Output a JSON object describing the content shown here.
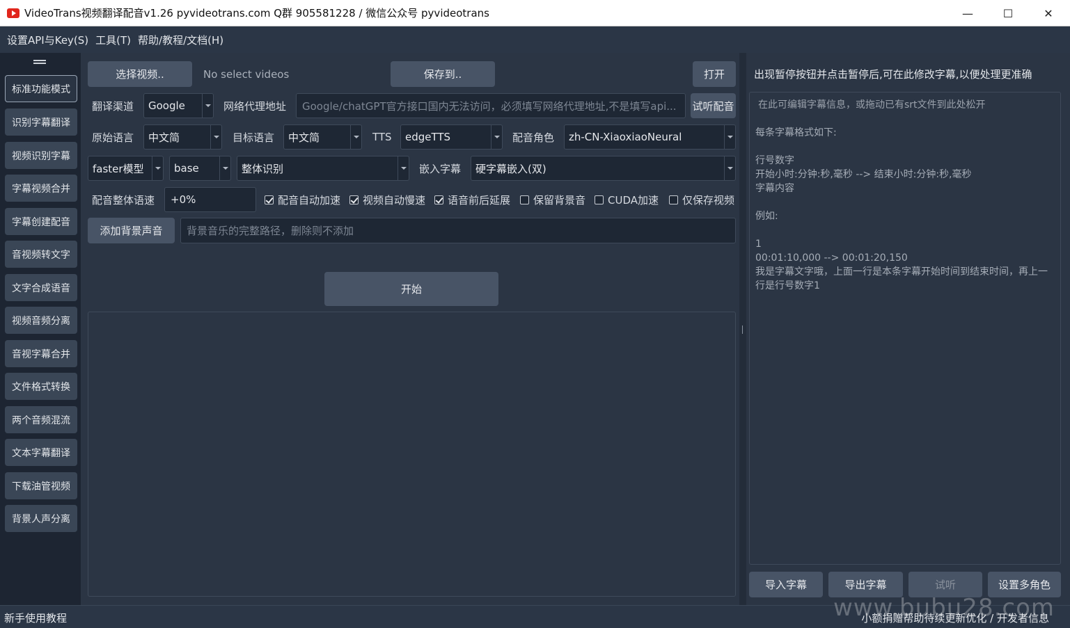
{
  "window": {
    "title": "VideoTrans视频翻译配音v1.26  pyvideotrans.com   Q群 905581228 / 微信公众号 pyvideotrans",
    "minimize": "—",
    "maximize": "☐",
    "close": "✕"
  },
  "menu": {
    "items": [
      "设置API与Key(S)",
      "工具(T)",
      "帮助/教程/文档(H)"
    ]
  },
  "sidebar": {
    "items": [
      "标准功能模式",
      "识别字幕翻译",
      "视频识别字幕",
      "字幕视频合并",
      "字幕创建配音",
      "音视频转文字",
      "文字合成语音",
      "视频音频分离",
      "音视字幕合并",
      "文件格式转换",
      "两个音频混流",
      "文本字幕翻译",
      "下载油管视频",
      "背景人声分离"
    ]
  },
  "main": {
    "select_video": "选择视频..",
    "no_video": "No select videos",
    "save_to": "保存到..",
    "open": "打开",
    "translate_channel_label": "翻译渠道",
    "translate_channel": "Google",
    "proxy_label": "网络代理地址",
    "proxy_placeholder": "Google/chatGPT官方接口国内无法访问，必须填写网络代理地址,不是填写api...",
    "listen_dub": "试听配音",
    "source_lang_label": "原始语言",
    "source_lang": "中文简",
    "target_lang_label": "目标语言",
    "target_lang": "中文简",
    "tts_label": "TTS",
    "tts": "edgeTTS",
    "voice_label": "配音角色",
    "voice": "zh-CN-XiaoxiaoNeural",
    "model_type": "faster模型",
    "model_size": "base",
    "recognition_mode": "整体识别",
    "embed_sub_label": "嵌入字幕",
    "embed_sub": "硬字幕嵌入(双)",
    "speed_label": "配音整体语速",
    "speed": "+0%",
    "checkboxes": [
      {
        "label": "配音自动加速",
        "checked": true
      },
      {
        "label": "视频自动慢速",
        "checked": true
      },
      {
        "label": "语音前后延展",
        "checked": true
      },
      {
        "label": "保留背景音",
        "checked": false
      },
      {
        "label": "CUDA加速",
        "checked": false
      },
      {
        "label": "仅保存视频",
        "checked": false
      }
    ],
    "add_bgm": "添加背景声音",
    "bgm_placeholder": "背景音乐的完整路径，删除则不添加",
    "start": "开始"
  },
  "right": {
    "tip": "出现暂停按钮并点击暂停后,可在此修改字幕,以便处理更准确",
    "editor_placeholder": "在此可编辑字幕信息，或拖动已有srt文件到此处松开",
    "editor_lines": [
      "每条字幕格式如下:",
      "",
      "行号数字",
      "开始小时:分钟:秒,毫秒 --> 结束小时:分钟:秒,毫秒",
      "字幕内容",
      "",
      "例如:",
      "",
      "1",
      "00:01:10,000 --> 00:01:20,150",
      "我是字幕文字哦，上面一行是本条字幕开始时间到结束时间，再上一行是行号数字1"
    ],
    "import_sub": "导入字幕",
    "export_sub": "导出字幕",
    "listen": "试听",
    "multi_role": "设置多角色"
  },
  "status": {
    "left": "新手使用教程",
    "right": "小额捐赠帮助待续更新优化 / 开发者信息"
  },
  "watermark": "www.bubu28.com"
}
